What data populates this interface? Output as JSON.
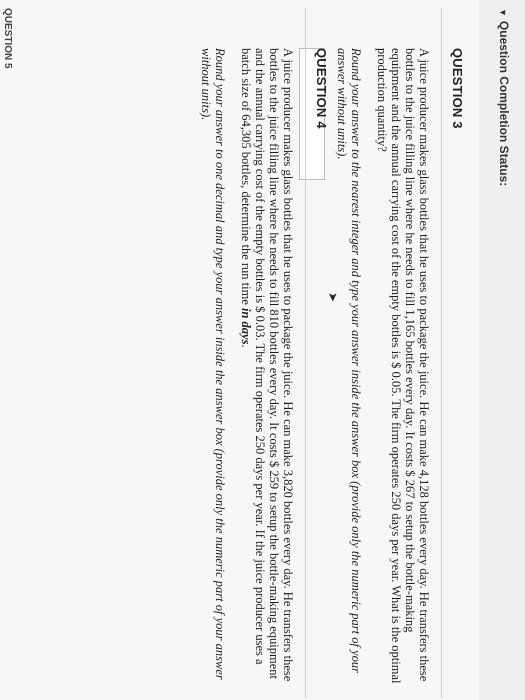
{
  "status": {
    "label": "Question Completion Status:"
  },
  "questions": [
    {
      "header": "QUESTION 3",
      "text": "A juice producer makes glass bottles that he uses to package the juice. He can make 4,128 bottles every day. He transfers these bottles to the juice filling line where he needs to fill 1,165 bottles every day. It costs $ 267 to setup the bottle-making equipment and the annual carrying cost of the empty bottles is $ 0.05. The firm operates 250 days per year. What is the optimal production quantity?",
      "instruction": "Round your answer to the nearest integer and type your answer inside the answer box (provide only the numeric part of your answer without units).",
      "answer_value": ""
    },
    {
      "header": "QUESTION 4",
      "text_before_emphasis": "A juice producer makes glass bottles that he uses to package the juice. He can make 3,820 bottles every day. He transfers these bottles to the juice filling line where he needs to fill 810 bottles every day. It costs $ 259 to setup the bottle-making equipment and the annual carrying cost of the empty bottles is $ 0.03. The firm operates 250 days per year. If the juice producer uses a batch size of 64,305 bottles, determine the run time ",
      "text_emphasis": "in days",
      "text_after_emphasis": ".",
      "instruction": "Round your answer to one decimal and type your answer inside the answer box (provide only the numeric part of your answer without units)."
    }
  ],
  "next_section_label": "QUESTION 5"
}
